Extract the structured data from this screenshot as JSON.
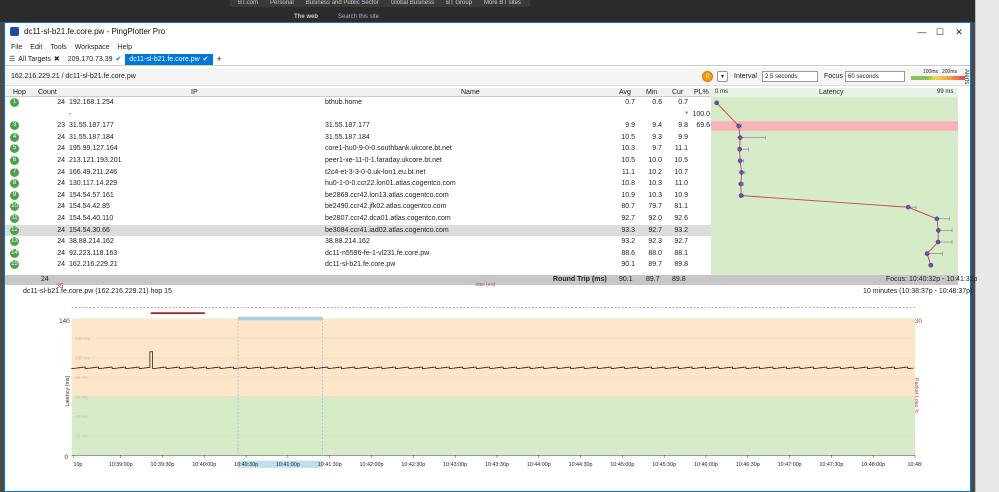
{
  "background": {
    "nav": [
      "BT.com",
      "Personal",
      "Business and Public Sector",
      "Global Business",
      "BT Group",
      "More BT sites"
    ],
    "heading": "The web",
    "search_link": "Search this site"
  },
  "window": {
    "title": "dc11-sl-b21.fe.core.pw - PingPlotter Pro",
    "minimize": "—",
    "maximize": "☐",
    "close": "✕"
  },
  "menu": [
    "File",
    "Edit",
    "Tools",
    "Workspace",
    "Help"
  ],
  "tabs": {
    "all_targets": "All Targets",
    "tab1": "209.170.73.39",
    "tab2": "dc11-sl-b21.fe.core.pw",
    "add": "+"
  },
  "pathbar": {
    "path": "162.216.229.21 / dc11-sl-b21.fe.core.pw",
    "interval_label": "Interval",
    "interval_value": "2.5 seconds",
    "focus_label": "Focus",
    "focus_value": "60 seconds",
    "scale_100": "100ms",
    "scale_200": "200ms",
    "alerts": "Alerts"
  },
  "table": {
    "headers": {
      "hop": "Hop",
      "count": "Count",
      "ip": "IP",
      "name": "Name",
      "avg": "Avg",
      "min": "Min",
      "cur": "Cur",
      "pl": "PL%",
      "latency": "Latency",
      "lat_min": "0 ms",
      "lat_max": "99 ms"
    },
    "rows": [
      {
        "hop": "1",
        "count": "24",
        "ip": "192.168.1.254",
        "name": "bthub.home",
        "avg": "0.7",
        "min": "0.6",
        "cur": "0.7",
        "pl": "",
        "ms": 0.7,
        "lo": 0.6,
        "hi": 0.9,
        "loss": false
      },
      {
        "hop": "",
        "count": "",
        "ip": "-",
        "name": "",
        "avg": "",
        "min": "",
        "cur": "*",
        "pl": "100.0",
        "ms": null,
        "lo": null,
        "hi": null,
        "loss": false
      },
      {
        "hop": "3",
        "count": "23",
        "ip": "31.55.187.177",
        "name": "31.55.187.177",
        "avg": "9.9",
        "min": "9.4",
        "cur": "9.8",
        "pl": "69.6",
        "ms": 9.9,
        "lo": 9.4,
        "hi": 11.0,
        "loss": true
      },
      {
        "hop": "4",
        "count": "24",
        "ip": "31.55.187.184",
        "name": "31.55.187.184",
        "avg": "10.5",
        "min": "9.3",
        "cur": "9.9",
        "pl": "",
        "ms": 10.5,
        "lo": 9.3,
        "hi": 21.0,
        "loss": false
      },
      {
        "hop": "5",
        "count": "24",
        "ip": "195.99.127.164",
        "name": "core1-hu0-9-0-0.southbank.ukcore.bt.net",
        "avg": "10.3",
        "min": "9.7",
        "cur": "11.1",
        "pl": "",
        "ms": 10.3,
        "lo": 9.7,
        "hi": 14.0,
        "loss": false
      },
      {
        "hop": "6",
        "count": "24",
        "ip": "213.121.193.201",
        "name": "peer1-xe-11-0-1.faraday.ukcore.bt.net",
        "avg": "10.5",
        "min": "10.0",
        "cur": "10.5",
        "pl": "",
        "ms": 10.5,
        "lo": 10.0,
        "hi": 12.0,
        "loss": false
      },
      {
        "hop": "7",
        "count": "24",
        "ip": "166.49.211.246",
        "name": "t2c4-et-3-3-0-0.uk-lon1.eu.bt.net",
        "avg": "11.1",
        "min": "10.2",
        "cur": "10.7",
        "pl": "",
        "ms": 11.1,
        "lo": 10.2,
        "hi": 12.5,
        "loss": false
      },
      {
        "hop": "8",
        "count": "24",
        "ip": "130.117.14.229",
        "name": "hu0-1-0-0.ccr22.lon01.atlas.cogentco.com",
        "avg": "10.8",
        "min": "10.3",
        "cur": "11.0",
        "pl": "",
        "ms": 10.8,
        "lo": 10.3,
        "hi": 11.8,
        "loss": false
      },
      {
        "hop": "9",
        "count": "24",
        "ip": "154.54.57.161",
        "name": "be2869.ccr42.lon13.atlas.cogentco.com",
        "avg": "10.9",
        "min": "10.3",
        "cur": "10.9",
        "pl": "",
        "ms": 10.9,
        "lo": 10.3,
        "hi": 11.8,
        "loss": false
      },
      {
        "hop": "10",
        "count": "24",
        "ip": "154.54.42.85",
        "name": "be2490.ccr42.jfk02.atlas.cogentco.com",
        "avg": "80.7",
        "min": "79.7",
        "cur": "81.1",
        "pl": "",
        "ms": 80.7,
        "lo": 79.7,
        "hi": 84.0,
        "loss": false
      },
      {
        "hop": "11",
        "count": "24",
        "ip": "154.54.40.110",
        "name": "be2807.ccr42.dca01.atlas.cogentco.com",
        "avg": "92.7",
        "min": "92.0",
        "cur": "92.6",
        "pl": "",
        "ms": 92.7,
        "lo": 92.0,
        "hi": 98.0,
        "loss": false
      },
      {
        "hop": "12",
        "count": "24",
        "ip": "154.54.30.66",
        "name": "be3084.ccr41.iad02.atlas.cogentco.com",
        "avg": "93.3",
        "min": "92.7",
        "cur": "93.2",
        "pl": "",
        "ms": 93.3,
        "lo": 92.7,
        "hi": 99.0,
        "loss": false,
        "selected": true
      },
      {
        "hop": "13",
        "count": "24",
        "ip": "38.88.214.162",
        "name": "38.88.214.162",
        "avg": "93.2",
        "min": "92.3",
        "cur": "92.7",
        "pl": "",
        "ms": 93.2,
        "lo": 92.3,
        "hi": 99.0,
        "loss": false
      },
      {
        "hop": "14",
        "count": "24",
        "ip": "92.223.118.163",
        "name": "dc11-n5596-fe-1-vl231.fe.core.pw",
        "avg": "88.6",
        "min": "88.0",
        "cur": "88.1",
        "pl": "",
        "ms": 88.6,
        "lo": 88.0,
        "hi": 95.0,
        "loss": false
      },
      {
        "hop": "15",
        "count": "24",
        "ip": "162.216.229.21",
        "name": "dc11-sl-b21.fe.core.pw",
        "avg": "90.1",
        "min": "89.7",
        "cur": "89.8",
        "pl": "",
        "ms": 90.1,
        "lo": 89.7,
        "hi": 91.0,
        "loss": false
      }
    ],
    "roundtrip": {
      "count": "24",
      "label": "Round Trip (ms)",
      "avg": "90.1",
      "min": "89.7",
      "cur": "89.8",
      "focus": "Focus: 10:40:32p - 10:41:32p"
    }
  },
  "graph": {
    "title": "dc11-sl-b21.fe.core.pw (162.216.229.21) hop 15",
    "range": "10 minutes (10:38:37p - 10:48:37p)",
    "jitter_label": "Jitter (ms)",
    "jitter_35": "35",
    "ylabel": "Latency (ms)",
    "y2label": "Packet Loss %",
    "y_top": "140",
    "y_bottom": "0",
    "y2_top": "30",
    "grid_labels": [
      "120 ms",
      "100 ms",
      "80 ms",
      "60 ms",
      "40 ms",
      "20 ms"
    ],
    "xticks": [
      "10p",
      "10:39:00p",
      "10:39:30p",
      "10:40:00p",
      "10:40:30p",
      "10:41:00p",
      "10:41:30p",
      "10:42:00p",
      "10:42:30p",
      "10:43:00p",
      "10:43:30p",
      "10:44:00p",
      "10:44:30p",
      "10:45:00p",
      "10:45:30p",
      "10:46:00p",
      "10:46:30p",
      "10:47:00p",
      "10:47:30p",
      "10:48:00p",
      "10:48:"
    ]
  },
  "colors": {
    "accent": "#0078d7",
    "good": "#d6ecc9",
    "warn": "#fce5c8",
    "loss": "#f7b3b7",
    "line": "#d9364a",
    "hop_badge": "#4aa34a"
  }
}
